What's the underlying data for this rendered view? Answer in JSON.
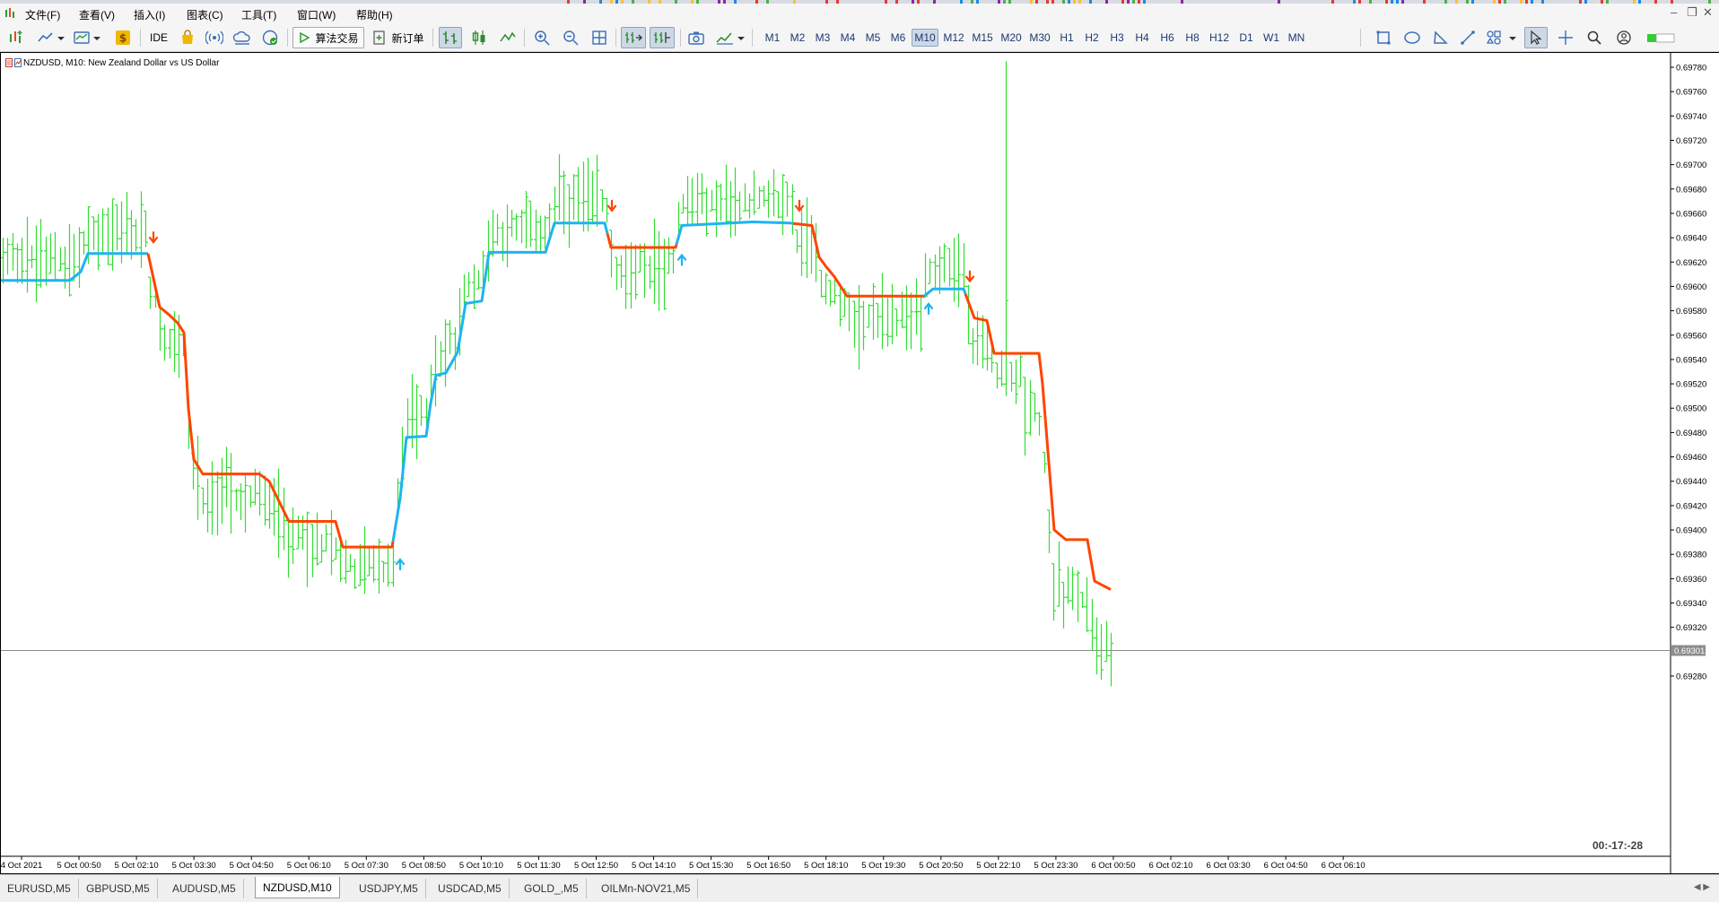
{
  "menu": {
    "items": [
      "文件(F)",
      "查看(V)",
      "插入(I)",
      "图表(C)",
      "工具(T)",
      "窗口(W)",
      "帮助(H)"
    ]
  },
  "toolbar": {
    "ide_label": "IDE",
    "algo_trading_label": "算法交易",
    "new_order_label": "新订单",
    "timeframes": [
      "M1",
      "M2",
      "M3",
      "M4",
      "M5",
      "M6",
      "M10",
      "M12",
      "M15",
      "M20",
      "M30",
      "H1",
      "H2",
      "H3",
      "H4",
      "H6",
      "H8",
      "H12",
      "D1",
      "W1",
      "MN"
    ],
    "active_timeframe": "M10"
  },
  "chart": {
    "header": "NZDUSD, M10:  New Zealand Dollar vs US Dollar",
    "timer": "00:-17:-28",
    "current_price_label": "0.69301",
    "colors": {
      "bars": "#33dd33",
      "line_up": "#1eb4f0",
      "line_down": "#ff4500",
      "arrow_up": "#1eb4f0",
      "arrow_down": "#ff4500",
      "price_line": "#8c8c8c"
    }
  },
  "chart_data": {
    "type": "bar",
    "title": "NZDUSD, M10:  New Zealand Dollar vs US Dollar",
    "x_ticks": [
      "4 Oct 2021",
      "5 Oct 00:50",
      "5 Oct 02:10",
      "5 Oct 03:30",
      "5 Oct 04:50",
      "5 Oct 06:10",
      "5 Oct 07:30",
      "5 Oct 08:50",
      "5 Oct 10:10",
      "5 Oct 11:30",
      "5 Oct 12:50",
      "5 Oct 14:10",
      "5 Oct 15:30",
      "5 Oct 16:50",
      "5 Oct 18:10",
      "5 Oct 19:30",
      "5 Oct 20:50",
      "5 Oct 22:10",
      "5 Oct 23:30",
      "6 Oct 00:50",
      "6 Oct 02:10",
      "6 Oct 03:30",
      "6 Oct 04:50",
      "6 Oct 06:10"
    ],
    "y_ticks": [
      "0.69780",
      "0.69760",
      "0.69740",
      "0.69720",
      "0.69700",
      "0.69680",
      "0.69660",
      "0.69640",
      "0.69620",
      "0.69600",
      "0.69580",
      "0.69560",
      "0.69540",
      "0.69520",
      "0.69500",
      "0.69480",
      "0.69460",
      "0.69440",
      "0.69420",
      "0.69400",
      "0.69380",
      "0.69360",
      "0.69340",
      "0.69320",
      "0.69280"
    ],
    "ylim": [
      0.6927,
      0.6979
    ],
    "current_price": 0.69301,
    "bars": {
      "bar_count": 235,
      "ranges": [
        [
          0.6963,
          0.6958
        ],
        [
          0.6961,
          0.6953
        ],
        [
          0.6966,
          0.695
        ],
        [
          0.6963,
          0.6959
        ],
        [
          0.6962,
          0.6956
        ],
        [
          0.6968,
          0.6946
        ],
        [
          0.6953,
          0.6948
        ],
        [
          0.6946,
          0.6936
        ],
        [
          0.6946,
          0.6938
        ],
        [
          0.6942,
          0.6936
        ],
        [
          0.6938,
          0.6935
        ]
      ],
      "note": "green OHLC bars; approximate high/low envelope per segment"
    },
    "series": [
      {
        "name": "",
        "points": [
          [
            0,
            0.69605
          ],
          [
            78,
            0.69605
          ],
          [
            90,
            0.69612
          ],
          [
            98,
            0.69627
          ],
          [
            165,
            0.69627
          ],
          [
            178,
            0.69583
          ],
          [
            188,
            0.69577
          ],
          [
            198,
            0.6957
          ],
          [
            205,
            0.69562
          ],
          [
            210,
            0.695
          ],
          [
            216,
            0.69458
          ],
          [
            226,
            0.69446
          ],
          [
            289,
            0.69446
          ],
          [
            300,
            0.6944
          ],
          [
            310,
            0.69425
          ],
          [
            322,
            0.69407
          ],
          [
            374,
            0.69407
          ],
          [
            382,
            0.69386
          ],
          [
            437,
            0.69386
          ],
          [
            446,
            0.69426
          ],
          [
            453,
            0.69476
          ],
          [
            475,
            0.69477
          ],
          [
            480,
            0.69504
          ],
          [
            486,
            0.69527
          ],
          [
            497,
            0.69529
          ],
          [
            510,
            0.69546
          ],
          [
            519,
            0.69586
          ],
          [
            537,
            0.69588
          ],
          [
            545,
            0.69628
          ],
          [
            608,
            0.69628
          ],
          [
            618,
            0.69652
          ],
          [
            674,
            0.69652
          ],
          [
            681,
            0.69632
          ],
          [
            753,
            0.69632
          ],
          [
            760,
            0.6965
          ],
          [
            839,
            0.69653
          ],
          [
            881,
            0.69652
          ],
          [
            905,
            0.6965
          ],
          [
            913,
            0.69624
          ],
          [
            920,
            0.69617
          ],
          [
            930,
            0.69608
          ],
          [
            944,
            0.69592
          ],
          [
            1030,
            0.69592
          ],
          [
            1040,
            0.69598
          ],
          [
            1074,
            0.69598
          ],
          [
            1086,
            0.69574
          ],
          [
            1100,
            0.69572
          ],
          [
            1108,
            0.69545
          ],
          [
            1158,
            0.69545
          ],
          [
            1162,
            0.6952
          ],
          [
            1175,
            0.694
          ],
          [
            1188,
            0.69392
          ],
          [
            1212,
            0.69392
          ],
          [
            1220,
            0.69358
          ],
          [
            1238,
            0.69351
          ]
        ],
        "x_unit": "bar_index_px",
        "segments": [
          {
            "direction": "up",
            "from": 0,
            "to": 165
          },
          {
            "direction": "down",
            "from": 165,
            "to": 438
          },
          {
            "direction": "up",
            "from": 438,
            "to": 677
          },
          {
            "direction": "down",
            "from": 677,
            "to": 754
          },
          {
            "direction": "up",
            "from": 754,
            "to": 884
          },
          {
            "direction": "down",
            "from": 884,
            "to": 1030
          },
          {
            "direction": "up",
            "from": 1030,
            "to": 1076
          },
          {
            "direction": "down",
            "from": 1076,
            "to": 1238
          }
        ]
      }
    ],
    "arrows": [
      {
        "type": "down",
        "x": 171,
        "price": 0.6964
      },
      {
        "type": "up",
        "x": 446,
        "price": 0.69372
      },
      {
        "type": "down",
        "x": 682,
        "price": 0.69666
      },
      {
        "type": "up",
        "x": 760,
        "price": 0.69622
      },
      {
        "type": "down",
        "x": 891,
        "price": 0.69666
      },
      {
        "type": "up",
        "x": 1035,
        "price": 0.69582
      },
      {
        "type": "down",
        "x": 1081,
        "price": 0.69608
      }
    ],
    "grid": false,
    "xlabel": "",
    "ylabel": ""
  },
  "tabs": {
    "items": [
      "EURUSD,M5",
      "GBPUSD,M5",
      "AUDUSD,M5",
      "NZDUSD,M10",
      "USDJPY,M5",
      "USDCAD,M5",
      "GOLD_,M5",
      "OILMn-NOV21,M5"
    ],
    "active": "NZDUSD,M10"
  }
}
